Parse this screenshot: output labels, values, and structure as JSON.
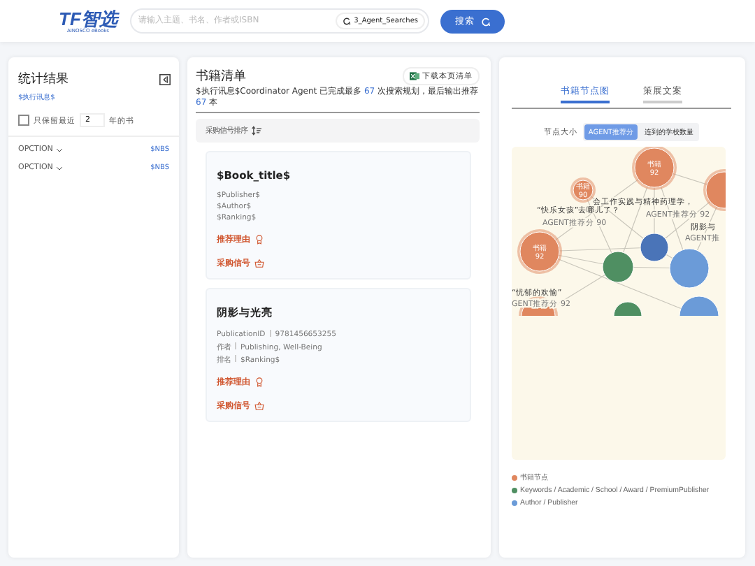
{
  "header": {
    "logo": "TF智选",
    "logo_sub": "AINOSCO eBooks",
    "search": {
      "placeholder": "请输入主题、书名、作者或ISBN"
    },
    "agent_chip": "3_Agent_Searches",
    "search_button": "搜索"
  },
  "stats": {
    "title": "统计结果",
    "subtitle": "$执行讯息$",
    "recent": {
      "label": "只保留最近",
      "checked": false,
      "value": "2",
      "suffix": "年的书"
    },
    "filters": [
      {
        "label": "OPCTION",
        "value": "$NBS"
      },
      {
        "label": "OPCTION",
        "value": "$NBS"
      }
    ]
  },
  "booklist": {
    "title": "书籍清单",
    "download": "下载本页清单",
    "info": [
      {
        "kind": "plain",
        "text": "$执行讯息$Coordinator Agent 已完成最多 "
      },
      {
        "kind": "highlight",
        "text": "67"
      },
      {
        "kind": "plain",
        "text": " 次搜索规划，最后输出推荐 "
      },
      {
        "kind": "highlight",
        "text": "67"
      },
      {
        "kind": "plain",
        "text": " 本"
      }
    ],
    "sort": "采购信号排序",
    "books": [
      {
        "title": "$Book_title$",
        "lines": [
          {
            "value": "$Publisher$"
          },
          {
            "value": "$Author$"
          },
          {
            "value": "$Ranking$"
          }
        ],
        "reason": "推荐理由",
        "signal": "采购信号"
      },
      {
        "title": "阴影与光亮",
        "lines": [
          {
            "label": "PublicationID",
            "value": "9781456653255"
          },
          {
            "label": "作者",
            "value": "Publishing, Well-Being"
          },
          {
            "label": "排名",
            "value": "$Ranking$"
          }
        ],
        "reason": "推荐理由",
        "signal": "采购信号"
      }
    ]
  },
  "graph_panel": {
    "tabs": [
      {
        "label": "书籍节点图",
        "selected": true
      },
      {
        "label": "策展文案",
        "selected": false
      }
    ],
    "size_label": "节点大小",
    "size_options": [
      {
        "label": "AGENT推荐分",
        "selected": true
      },
      {
        "label": "连到的学校数量",
        "selected": false
      }
    ],
    "nodes": [
      {
        "kind": "book",
        "color": "#e0875f",
        "text": [
          "书籍",
          "92"
        ]
      },
      {
        "kind": "book",
        "color": "#e0875f",
        "text": [
          "书籍",
          "90"
        ]
      },
      {
        "kind": "book",
        "color": "#e0875f"
      },
      {
        "kind": "book",
        "color": "#e0875f",
        "text": [
          "书籍",
          "92"
        ]
      },
      {
        "kind": "plain",
        "color": "#4a74b8"
      },
      {
        "kind": "plain",
        "color": "#4f8f62"
      },
      {
        "kind": "plain",
        "color": "#6b9bd8"
      },
      {
        "kind": "book",
        "color": "#e0875f"
      },
      {
        "kind": "plain",
        "color": "#4f8f62"
      },
      {
        "kind": "plain",
        "color": "#6b9bd8"
      }
    ],
    "labels": [
      "会工作实践与精神药理学，",
      "AGENT推荐分 92",
      "“快乐女孩”去哪儿了？",
      "AGENT推荐分 90",
      "阴影与",
      "AGENT推",
      "“忧郁的欢愉”",
      "GENT推荐分 92"
    ],
    "legend": [
      {
        "color": "#e0875f",
        "label": "书籍节点"
      },
      {
        "color": "#4f8f62",
        "label": "Keywords / Academic / School / Award / PremiumPublisher"
      },
      {
        "color": "#6b9bd8",
        "label": "Author / Publisher"
      }
    ]
  }
}
